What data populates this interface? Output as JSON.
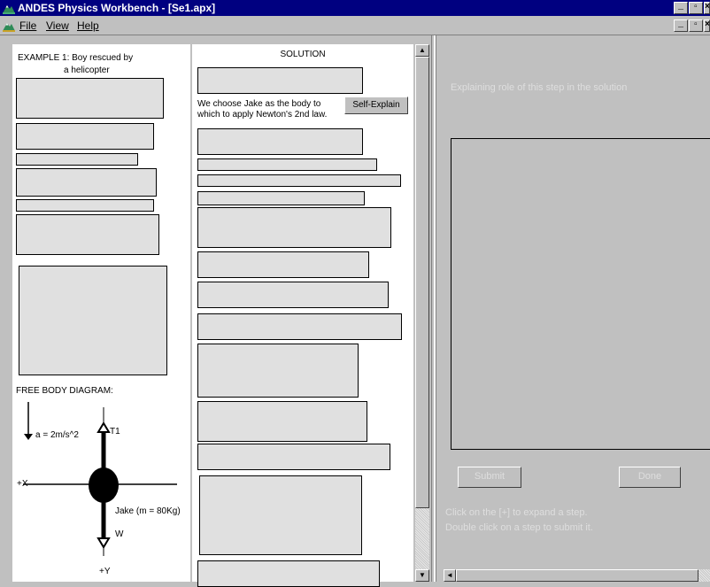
{
  "window": {
    "title": "ANDES Physics Workbench - [Se1.apx]",
    "controls": [
      "_",
      "▫",
      "×"
    ]
  },
  "menu": {
    "file": "File",
    "view": "View",
    "help": "Help"
  },
  "example": {
    "line1": "EXAMPLE 1: Boy rescued by",
    "line2": "a helicopter"
  },
  "fbd": {
    "label": "FREE BODY DIAGRAM:",
    "accel": "a = 2m/s^2",
    "t1": "T1",
    "px": "+X",
    "py": "+Y",
    "jake": "Jake (m = 80Kg)",
    "w": "W"
  },
  "solution": {
    "header": "SOLUTION",
    "step_text_1": "We choose Jake as the body to",
    "step_text_2": "which to apply Newton's 2nd law.",
    "self_explain": "Self-Explain"
  },
  "explain_panel": {
    "heading": "Explaining role of this step in the solution",
    "submit": "Submit",
    "done": "Done",
    "hint1": "Click on the [+] to expand a step.",
    "hint2": "Double click on a step to submit it."
  },
  "colors": {
    "title_bar": "#000080",
    "box_fill": "#e0e0e0",
    "panel_bg": "#c0c0c0"
  }
}
